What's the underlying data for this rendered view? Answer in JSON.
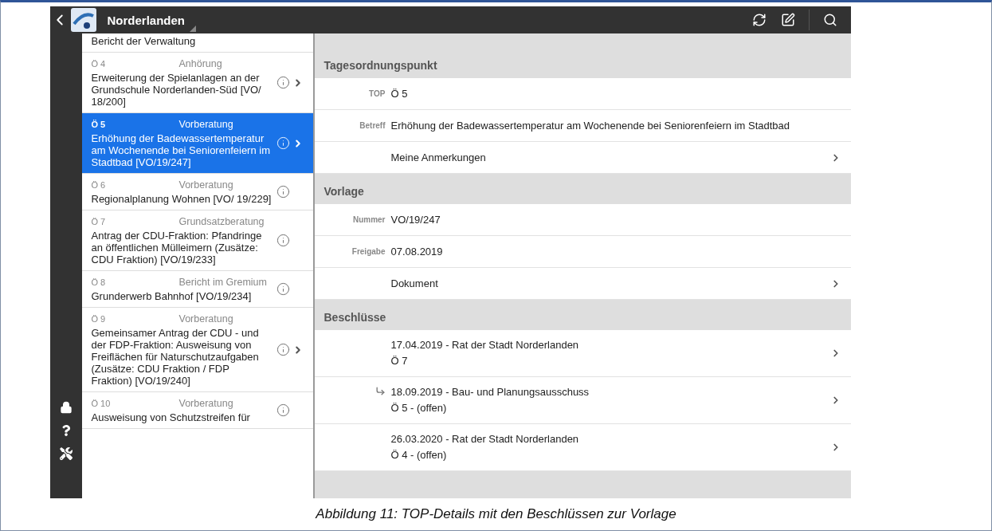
{
  "app_bar": {
    "title": "Norderlanden"
  },
  "agenda_partial_title": "Bericht der Verwaltung",
  "agenda_items": [
    {
      "number": "Ö 4",
      "phase": "Anhörung",
      "title": "Erweiterung der Spielanlagen an der Grundschule Norderlanden-Süd [VO/ 18/200]",
      "chevron": true,
      "selected": false
    },
    {
      "number": "Ö 5",
      "phase": "Vorberatung",
      "title": "Erhöhung der Badewassertemperatur am Wochenende bei Seniorenfeiern im Stadtbad [VO/19/247]",
      "chevron": true,
      "selected": true
    },
    {
      "number": "Ö 6",
      "phase": "Vorberatung",
      "title": "Regionalplanung Wohnen [VO/ 19/229]",
      "chevron": false,
      "selected": false
    },
    {
      "number": "Ö 7",
      "phase": "Grundsatzberatung",
      "title": "Antrag der CDU-Fraktion: Pfandringe an öffentlichen Mülleimern (Zusätze: CDU Fraktion) [VO/19/233]",
      "chevron": false,
      "selected": false
    },
    {
      "number": "Ö 8",
      "phase": "Bericht im Gremium",
      "title": "Grunderwerb Bahnhof [VO/19/234]",
      "chevron": false,
      "selected": false
    },
    {
      "number": "Ö 9",
      "phase": "Vorberatung",
      "title": "Gemeinsamer Antrag der CDU - und der FDP-Fraktion: Ausweisung von Freiflächen für Naturschutzaufgaben (Zusätze: CDU Fraktion / FDP Fraktion) [VO/19/240]",
      "chevron": true,
      "selected": false
    },
    {
      "number": "Ö 10",
      "phase": "Vorberatung",
      "title": "Ausweisung von Schutzstreifen für",
      "chevron": false,
      "selected": false
    }
  ],
  "sections": [
    {
      "title": "Tagesordnungspunkt",
      "rows": [
        {
          "kind": "field",
          "label": "TOP",
          "value": "Ö 5"
        },
        {
          "kind": "field",
          "label": "Betreff",
          "value": "Erhöhung der Badewassertemperatur am Wochenende bei Seniorenfeiern im Stadtbad"
        },
        {
          "kind": "link",
          "value": "Meine Anmerkungen"
        }
      ]
    },
    {
      "title": "Vorlage",
      "rows": [
        {
          "kind": "field",
          "label": "Nummer",
          "value": "VO/19/247"
        },
        {
          "kind": "field",
          "label": "Freigabe",
          "value": "07.08.2019"
        },
        {
          "kind": "link",
          "value": "Dokument"
        }
      ]
    },
    {
      "title": "Beschlüsse",
      "rows": [
        {
          "kind": "decision",
          "line1": "17.04.2019 - Rat der Stadt Norderlanden",
          "line2": "Ö 7",
          "forwarded": false
        },
        {
          "kind": "decision",
          "line1": "18.09.2019 - Bau- und Planungsausschuss",
          "line2": "Ö 5 - (offen)",
          "forwarded": true
        },
        {
          "kind": "decision",
          "line1": "26.03.2020 - Rat der Stadt Norderlanden",
          "line2": "Ö 4 - (offen)",
          "forwarded": false
        }
      ]
    }
  ],
  "caption": "Abbildung 11: TOP-Details mit den Beschlüssen zur Vorlage"
}
